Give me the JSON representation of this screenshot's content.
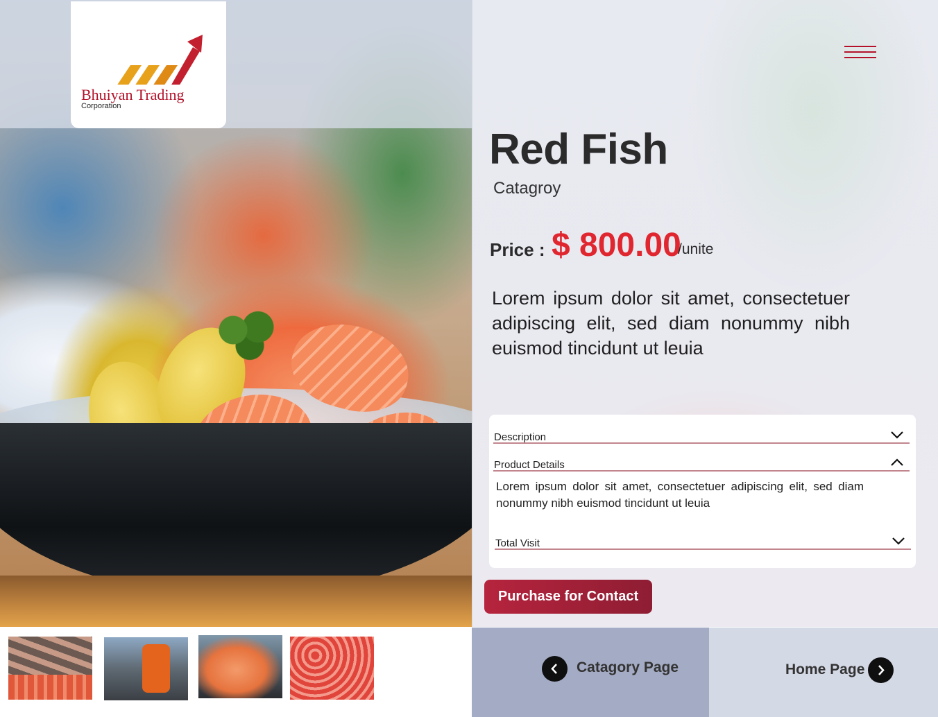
{
  "brand": {
    "name": "Bhuiyan Trading",
    "sub": "Corporation"
  },
  "product": {
    "title": "Red Fish",
    "category": "Catagroy",
    "price_label": "Price :",
    "price_value": "$ 800.00",
    "price_unit": "/unite",
    "summary": "Lorem ipsum dolor sit amet, consectetuer adipiscing elit, sed diam nonummy nibh euismod tincidunt ut leuia"
  },
  "accordion": {
    "items": [
      {
        "label": "Description",
        "state": "collapsed"
      },
      {
        "label": "Product Details",
        "state": "expanded",
        "body": "Lorem ipsum dolor sit amet, consectetuer adipiscing elit, sed diam nonummy nibh euismod tincidunt ut leuia"
      },
      {
        "label": "Total Visit",
        "state": "collapsed"
      }
    ]
  },
  "actions": {
    "purchase_label": "Purchase for Contact"
  },
  "nav": {
    "back_label": "Catagory Page",
    "home_label": "Home Page"
  },
  "icons": {
    "menu": "hamburger-icon",
    "chevron_down": "chevron-down-icon",
    "chevron_up": "chevron-up-icon",
    "arrow_left": "chevron-left-icon",
    "arrow_right": "chevron-right-icon"
  },
  "colors": {
    "accent": "#b3122a",
    "price": "#e0262f",
    "button": "#b6243d"
  }
}
